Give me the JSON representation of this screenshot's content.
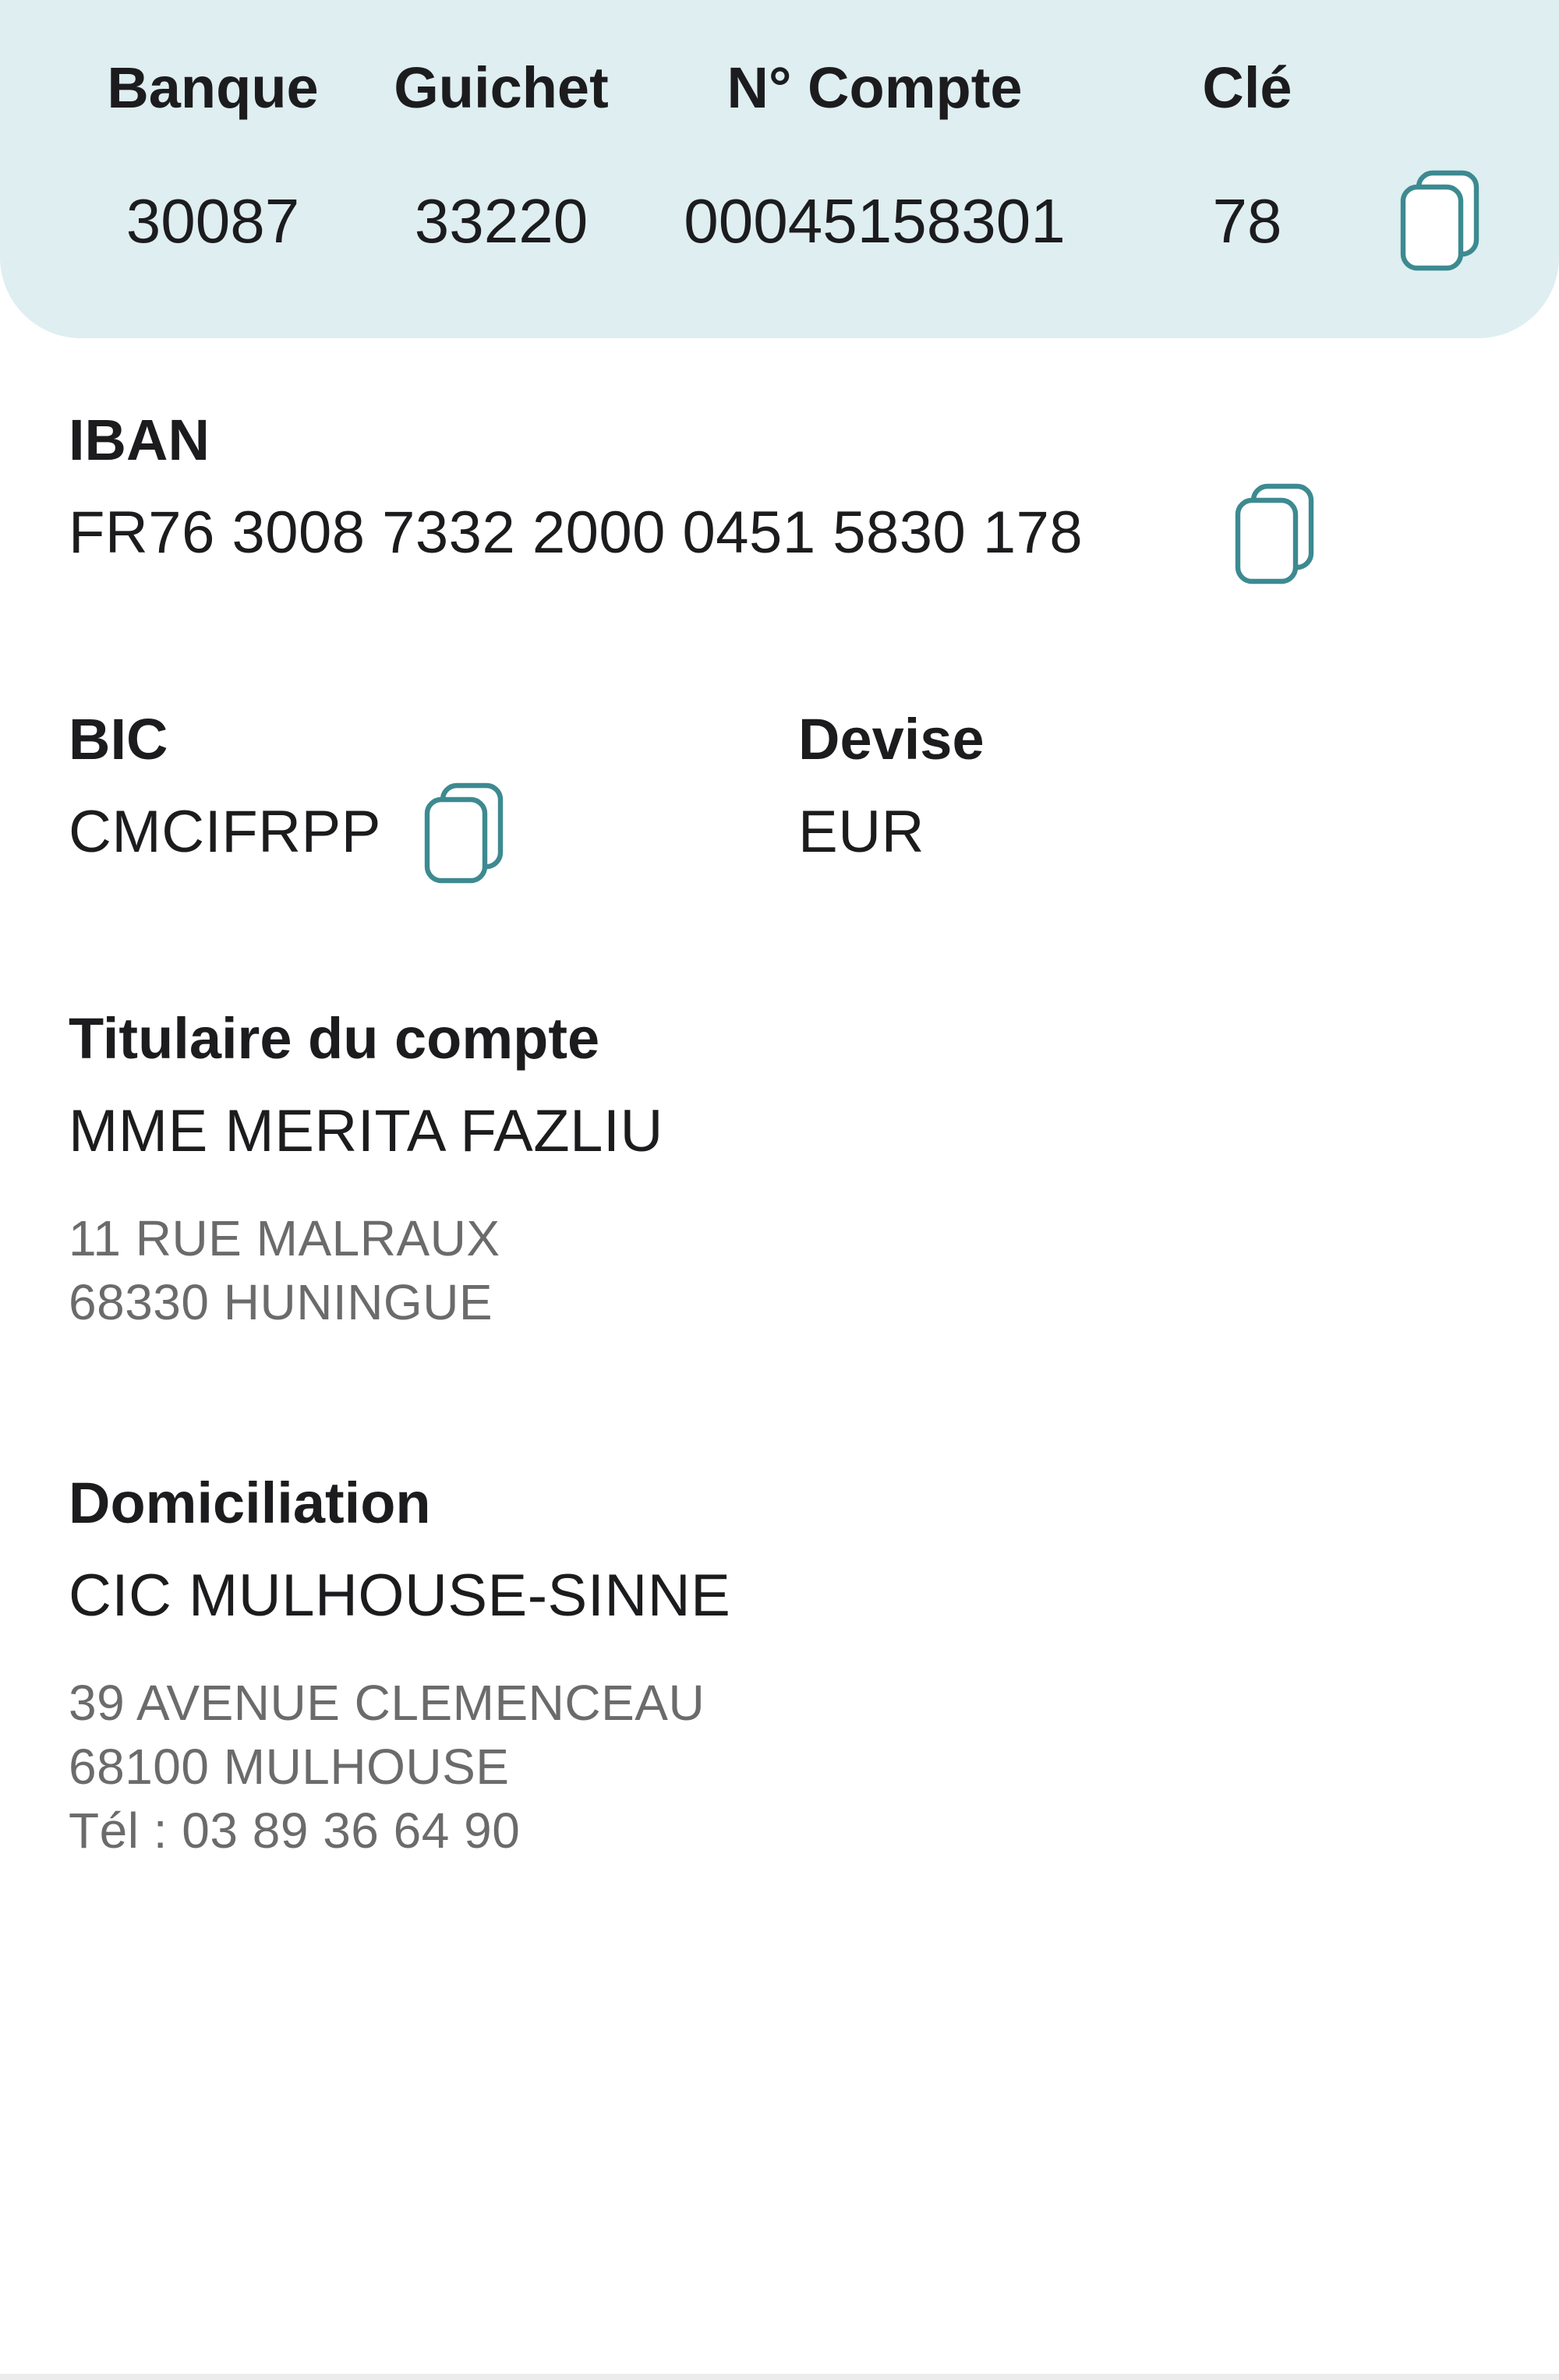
{
  "rib": {
    "headers": {
      "bank": "Banque",
      "branch": "Guichet",
      "account": "N° Compte",
      "key": "Clé"
    },
    "values": {
      "bank": "30087",
      "branch": "33220",
      "account": "00045158301",
      "key": "78"
    }
  },
  "iban": {
    "label": "IBAN",
    "value": "FR76 3008 7332 2000 0451 5830 178"
  },
  "bic": {
    "label": "BIC",
    "value": "CMCIFRPP"
  },
  "currency": {
    "label": "Devise",
    "value": "EUR"
  },
  "holder": {
    "label": "Titulaire du compte",
    "name": "MME MERITA FAZLIU",
    "address_line1": "11 RUE MALRAUX",
    "address_line2": "68330 HUNINGUE"
  },
  "domiciliation": {
    "label": "Domiciliation",
    "name": "CIC MULHOUSE-SINNE",
    "address_line1": "39 AVENUE CLEMENCEAU",
    "address_line2": "68100 MULHOUSE",
    "phone": "Tél : 03 89 36 64 90"
  },
  "icons": {
    "copy": "copy-icon"
  },
  "colors": {
    "panel_background": "#deeef1",
    "icon_stroke": "#3d8a91",
    "text_primary": "#1c1c1e",
    "text_secondary": "#6b6b6b"
  }
}
